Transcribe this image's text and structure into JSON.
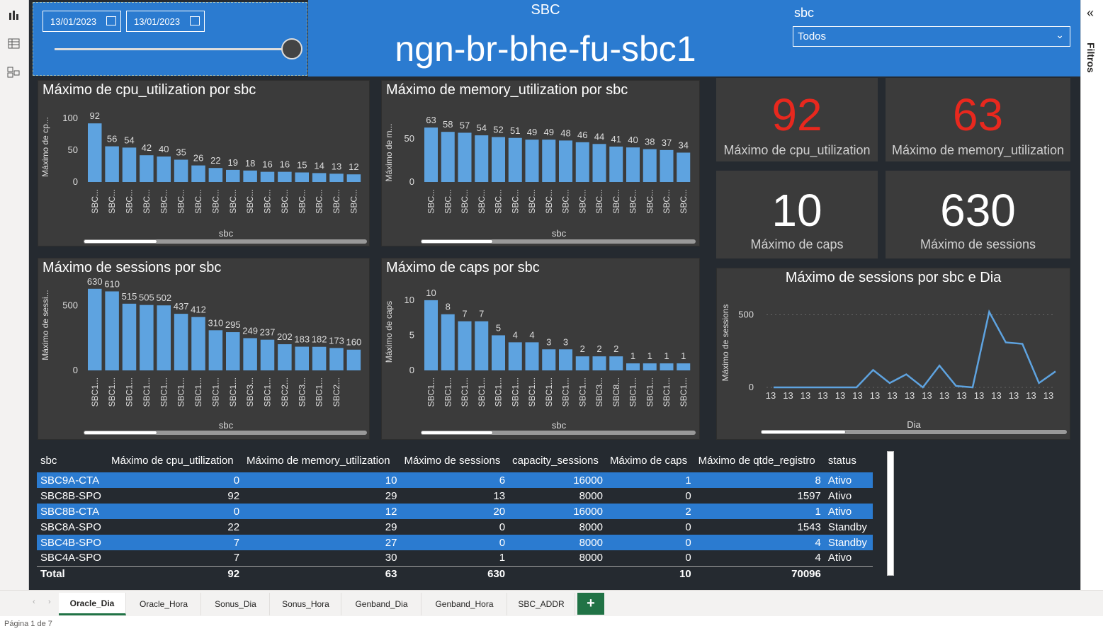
{
  "slicer": {
    "date_from": "13/01/2023",
    "date_to": "13/01/2023"
  },
  "header": {
    "label": "SBC",
    "sbc_name": "ngn-br-bhe-fu-sbc1",
    "filter_label": "sbc",
    "filter_value": "Todos"
  },
  "filters_pane": {
    "title": "Filtros"
  },
  "charts": [
    {
      "type": "bar",
      "title": "Máximo de cpu_utilization por sbc",
      "ylabel": "Máximo de cp...",
      "xlabel": "sbc",
      "yticks": [
        0,
        50,
        100
      ],
      "ymax": 110,
      "categories": [
        "SBC...",
        "SBC...",
        "SBC...",
        "SBC...",
        "SBC...",
        "SBC...",
        "SBC...",
        "SBC...",
        "SBC...",
        "SBC...",
        "SBC...",
        "SBC...",
        "SBC...",
        "SBC...",
        "SBC...",
        "SBC..."
      ],
      "values": [
        92,
        56,
        54,
        42,
        40,
        35,
        26,
        22,
        19,
        18,
        16,
        16,
        15,
        14,
        13,
        12
      ]
    },
    {
      "type": "bar",
      "title": "Máximo de memory_utilization por sbc",
      "ylabel": "Máximo de m...",
      "xlabel": "sbc",
      "yticks": [
        0,
        50
      ],
      "ymax": 68,
      "categories": [
        "SBC...",
        "SBC...",
        "SBC...",
        "SBC...",
        "SBC...",
        "SBC...",
        "SBC...",
        "SBC...",
        "SBC...",
        "SBC...",
        "SBC...",
        "SBC...",
        "SBC...",
        "SBC...",
        "SBC...",
        "SBC..."
      ],
      "values": [
        63,
        58,
        57,
        54,
        52,
        51,
        49,
        49,
        48,
        46,
        44,
        41,
        40,
        38,
        37,
        34
      ]
    },
    {
      "type": "bar",
      "title": "Máximo de sessions por sbc",
      "ylabel": "Máximo de sessi...",
      "xlabel": "sbc",
      "yticks": [
        0,
        500
      ],
      "ymax": 700,
      "categories": [
        "SBC1...",
        "SBC1...",
        "SBC1...",
        "SBC1...",
        "SBC1...",
        "SBC1...",
        "SBC1...",
        "SBC1...",
        "SBC1...",
        "SBC3...",
        "SBC1...",
        "SBC2...",
        "SBC3...",
        "SBC1...",
        "SBC2..."
      ],
      "values": [
        630,
        610,
        515,
        505,
        502,
        437,
        412,
        310,
        295,
        249,
        237,
        202,
        183,
        182,
        173,
        160
      ]
    },
    {
      "type": "bar",
      "title": "Máximo de caps por sbc",
      "ylabel": "Máximo de caps",
      "xlabel": "sbc",
      "yticks": [
        0,
        5,
        10
      ],
      "ymax": 11,
      "categories": [
        "SBC1...",
        "SBC1...",
        "SBC1...",
        "SBC1...",
        "SBC1...",
        "SBC1...",
        "SBC1...",
        "SBC1...",
        "SBC1...",
        "SBC1...",
        "SBC3...",
        "SBC8...",
        "SBC1...",
        "SBC1...",
        "SBC1...",
        "SBC1..."
      ],
      "values": [
        10,
        8,
        7,
        7,
        5,
        4,
        4,
        3,
        3,
        2,
        2,
        2,
        1,
        1,
        1,
        1
      ]
    },
    {
      "type": "line",
      "title": "Máximo de sessions por sbc e Dia",
      "ylabel": "Máximo de sessions",
      "xlabel": "Dia",
      "yticks": [
        0,
        500
      ],
      "ymax": 600,
      "categories": [
        "13",
        "13",
        "13",
        "13",
        "13",
        "13",
        "13",
        "13",
        "13",
        "13",
        "13",
        "13",
        "13",
        "13",
        "13",
        "13",
        "13"
      ],
      "values": [
        0,
        0,
        0,
        0,
        0,
        0,
        120,
        30,
        90,
        0,
        150,
        10,
        0,
        520,
        310,
        300,
        30,
        110
      ]
    }
  ],
  "cards": [
    {
      "value": "92",
      "label": "Máximo de cpu_utilization",
      "color": "#e8281e"
    },
    {
      "value": "63",
      "label": "Máximo de memory_utilization",
      "color": "#e8281e"
    },
    {
      "value": "10",
      "label": "Máximo de caps",
      "color": "#ffffff"
    },
    {
      "value": "630",
      "label": "Máximo de sessions",
      "color": "#ffffff"
    }
  ],
  "table": {
    "headers": [
      "sbc",
      "Máximo de cpu_utilization",
      "Máximo de memory_utilization",
      "Máximo de sessions",
      "capacity_sessions",
      "Máximo de caps",
      "Máximo de qtde_registro",
      "status"
    ],
    "rows": [
      [
        "SBC9A-CTA",
        "0",
        "10",
        "6",
        "16000",
        "1",
        "8",
        "Ativo"
      ],
      [
        "SBC8B-SPO",
        "92",
        "29",
        "13",
        "8000",
        "0",
        "1597",
        "Ativo"
      ],
      [
        "SBC8B-CTA",
        "0",
        "12",
        "20",
        "16000",
        "2",
        "1",
        "Ativo"
      ],
      [
        "SBC8A-SPO",
        "22",
        "29",
        "0",
        "8000",
        "0",
        "1543",
        "Standby"
      ],
      [
        "SBC4B-SPO",
        "7",
        "27",
        "0",
        "8000",
        "0",
        "4",
        "Standby"
      ],
      [
        "SBC4A-SPO",
        "7",
        "30",
        "1",
        "8000",
        "0",
        "4",
        "Ativo"
      ]
    ],
    "total": [
      "Total",
      "92",
      "63",
      "630",
      "",
      "10",
      "70096",
      ""
    ]
  },
  "tabs": [
    "Oracle_Dia",
    "Oracle_Hora",
    "Sonus_Dia",
    "Sonus_Hora",
    "Genband_Dia",
    "Genband_Hora",
    "SBC_ADDR"
  ],
  "status": "Página 1 de 7"
}
